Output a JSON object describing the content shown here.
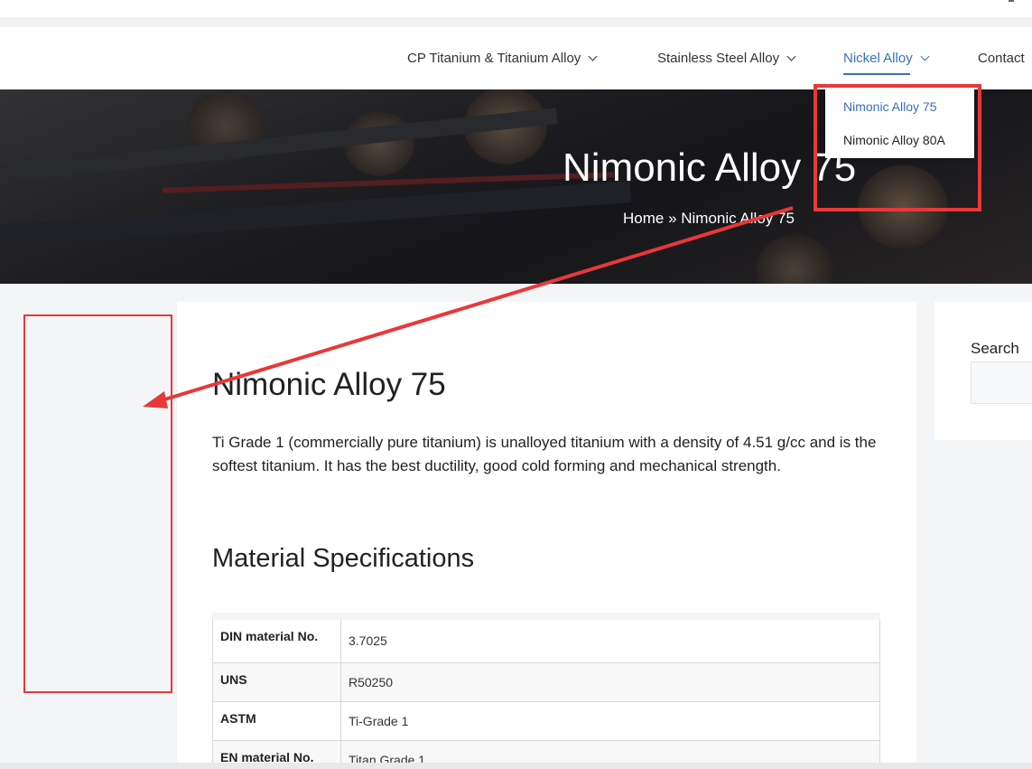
{
  "nav": {
    "items": [
      {
        "label": "CP Titanium & Titanium Alloy",
        "has_dropdown": true
      },
      {
        "label": "Stainless Steel Alloy",
        "has_dropdown": true
      },
      {
        "label": "Nickel Alloy",
        "has_dropdown": true,
        "active": true
      },
      {
        "label": "Contact",
        "has_dropdown": false
      }
    ],
    "dropdown": [
      {
        "label": "Nimonic Alloy 75",
        "active": true
      },
      {
        "label": "Nimonic Alloy 80A"
      }
    ]
  },
  "hero": {
    "title": "Nimonic Alloy 75",
    "breadcrumb": "Home » Nimonic Alloy 75"
  },
  "article": {
    "title": "Nimonic Alloy 75",
    "intro": "Ti Grade 1 (commercially pure titanium) is unalloyed titanium with a density of 4.51 g/cc and is the softest titanium. It has the best ductility, good cold forming and mechanical strength.",
    "spec_heading": "Material Specifications",
    "specs": [
      {
        "key": "DIN material No.",
        "value": "3.7025"
      },
      {
        "key": "UNS",
        "value": "R50250"
      },
      {
        "key": "ASTM",
        "value": "Ti-Grade 1"
      },
      {
        "key": "EN material No.",
        "value": "Titan Grade 1"
      }
    ]
  },
  "sidebar": {
    "search_label": "Search",
    "search_value": ""
  },
  "colors": {
    "accent": "#3a6fb8",
    "annotation": "#e8383a",
    "text": "#222222"
  },
  "icons": {
    "dropdown": "chevron-down-icon"
  }
}
